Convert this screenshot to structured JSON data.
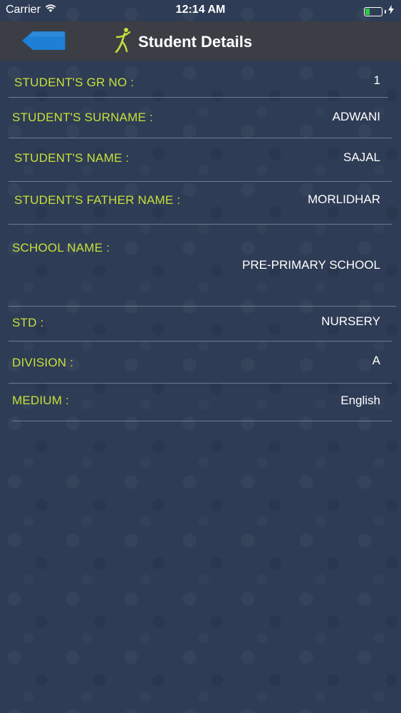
{
  "status_bar": {
    "carrier": "Carrier",
    "time": "12:14 AM",
    "battery_color": "#2ecc40"
  },
  "nav": {
    "title": "Student Details",
    "back_button_color": "#1e7fd6",
    "logo_color": "#c6e03a"
  },
  "accent": {
    "label_color": "#c6e03a",
    "value_color": "#ffffff"
  },
  "details": {
    "gr_no": {
      "label": "STUDENT'S GR NO :",
      "value": "1"
    },
    "surname": {
      "label": "STUDENT'S SURNAME :",
      "value": "ADWANI"
    },
    "name": {
      "label": "STUDENT'S NAME :",
      "value": "SAJAL"
    },
    "father_name": {
      "label": "STUDENT'S FATHER NAME :",
      "value": "MORLIDHAR"
    },
    "school_name": {
      "label": "SCHOOL NAME :",
      "value": "PRE-PRIMARY SCHOOL"
    },
    "std": {
      "label": "STD :",
      "value": "NURSERY"
    },
    "division": {
      "label": "DIVISION :",
      "value": "A"
    },
    "medium": {
      "label": "MEDIUM :",
      "value": "English"
    }
  }
}
